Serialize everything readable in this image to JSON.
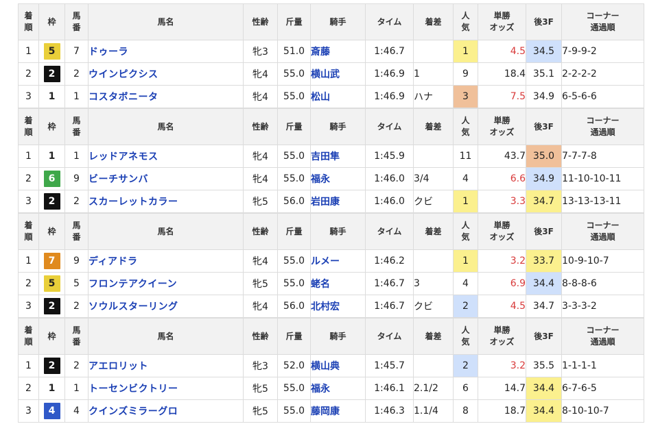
{
  "headers": {
    "chakujun": [
      "着",
      "順"
    ],
    "waku": "枠",
    "umaban": [
      "馬",
      "番"
    ],
    "bamei": "馬名",
    "seirei": "性齢",
    "kinryo": "斤量",
    "kishu": "騎手",
    "time": "タイム",
    "chakusa": "着差",
    "ninki": [
      "人",
      "気"
    ],
    "odds": [
      "単勝",
      "オッズ"
    ],
    "agari": "後3F",
    "corner": [
      "コーナー",
      "通過順"
    ]
  },
  "colors": {
    "waku1": "#ffffff",
    "waku2": "#111111",
    "waku4": "#2f58c8",
    "waku5": "#e9cf3a",
    "waku6": "#3fa84a",
    "waku7": "#e08a1e",
    "highlight_yellow": "#fbf08e",
    "highlight_blue": "#cfe0fb",
    "highlight_orange": "#f0c09a",
    "odds_red": "#d83a3a",
    "link_blue": "#1a3fb4"
  },
  "races": [
    {
      "rows": [
        {
          "rank": "1",
          "waku": "5",
          "umaban": "7",
          "name": "ドゥーラ",
          "seirei": "牝3",
          "kinryo": "51.0",
          "jockey": "斎藤",
          "time": "1:46.7",
          "margin": "",
          "ninki": "1",
          "ninki_hl": "yellow",
          "odds": "4.5",
          "odds_red": true,
          "agari": "34.5",
          "agari_hl": "blue",
          "corner": "7-9-9-2"
        },
        {
          "rank": "2",
          "waku": "2",
          "umaban": "2",
          "name": "ウインピクシス",
          "seirei": "牝4",
          "kinryo": "55.0",
          "jockey": "横山武",
          "time": "1:46.9",
          "margin": "1",
          "ninki": "9",
          "ninki_hl": "",
          "odds": "18.4",
          "odds_red": false,
          "agari": "35.1",
          "agari_hl": "",
          "corner": "2-2-2-2"
        },
        {
          "rank": "3",
          "waku": "1",
          "umaban": "1",
          "name": "コスタボニータ",
          "seirei": "牝4",
          "kinryo": "55.0",
          "jockey": "松山",
          "time": "1:46.9",
          "margin": "ハナ",
          "ninki": "3",
          "ninki_hl": "orange",
          "odds": "7.5",
          "odds_red": true,
          "agari": "34.9",
          "agari_hl": "",
          "corner": "6-5-6-6"
        }
      ]
    },
    {
      "rows": [
        {
          "rank": "1",
          "waku": "1",
          "umaban": "1",
          "name": "レッドアネモス",
          "seirei": "牝4",
          "kinryo": "55.0",
          "jockey": "吉田隼",
          "time": "1:45.9",
          "margin": "",
          "ninki": "11",
          "ninki_hl": "",
          "odds": "43.7",
          "odds_red": false,
          "agari": "35.0",
          "agari_hl": "orange",
          "corner": "7-7-7-8"
        },
        {
          "rank": "2",
          "waku": "6",
          "umaban": "9",
          "name": "ビーチサンバ",
          "seirei": "牝4",
          "kinryo": "55.0",
          "jockey": "福永",
          "time": "1:46.0",
          "margin": "3/4",
          "ninki": "4",
          "ninki_hl": "",
          "odds": "6.6",
          "odds_red": true,
          "agari": "34.9",
          "agari_hl": "blue",
          "corner": "11-10-10-11"
        },
        {
          "rank": "3",
          "waku": "2",
          "umaban": "2",
          "name": "スカーレットカラー",
          "seirei": "牝5",
          "kinryo": "56.0",
          "jockey": "岩田康",
          "time": "1:46.0",
          "margin": "クビ",
          "ninki": "1",
          "ninki_hl": "yellow",
          "odds": "3.3",
          "odds_red": true,
          "agari": "34.7",
          "agari_hl": "yellow",
          "corner": "13-13-13-11"
        }
      ]
    },
    {
      "rows": [
        {
          "rank": "1",
          "waku": "7",
          "umaban": "9",
          "name": "ディアドラ",
          "seirei": "牝4",
          "kinryo": "55.0",
          "jockey": "ルメー",
          "time": "1:46.2",
          "margin": "",
          "ninki": "1",
          "ninki_hl": "yellow",
          "odds": "3.2",
          "odds_red": true,
          "agari": "33.7",
          "agari_hl": "yellow",
          "corner": "10-9-10-7"
        },
        {
          "rank": "2",
          "waku": "5",
          "umaban": "5",
          "name": "フロンテアクイーン",
          "seirei": "牝5",
          "kinryo": "55.0",
          "jockey": "蛯名",
          "time": "1:46.7",
          "margin": "3",
          "ninki": "4",
          "ninki_hl": "",
          "odds": "6.9",
          "odds_red": true,
          "agari": "34.4",
          "agari_hl": "blue",
          "corner": "8-8-8-6"
        },
        {
          "rank": "3",
          "waku": "2",
          "umaban": "2",
          "name": "ソウルスターリング",
          "seirei": "牝4",
          "kinryo": "56.0",
          "jockey": "北村宏",
          "time": "1:46.7",
          "margin": "クビ",
          "ninki": "2",
          "ninki_hl": "blue",
          "odds": "4.5",
          "odds_red": true,
          "agari": "34.7",
          "agari_hl": "",
          "corner": "3-3-3-2"
        }
      ]
    },
    {
      "rows": [
        {
          "rank": "1",
          "waku": "2",
          "umaban": "2",
          "name": "アエロリット",
          "seirei": "牝3",
          "kinryo": "52.0",
          "jockey": "横山典",
          "time": "1:45.7",
          "margin": "",
          "ninki": "2",
          "ninki_hl": "blue",
          "odds": "3.2",
          "odds_red": true,
          "agari": "35.5",
          "agari_hl": "",
          "corner": "1-1-1-1"
        },
        {
          "rank": "2",
          "waku": "1",
          "umaban": "1",
          "name": "トーセンビクトリー",
          "seirei": "牝5",
          "kinryo": "55.0",
          "jockey": "福永",
          "time": "1:46.1",
          "margin": "2.1/2",
          "ninki": "6",
          "ninki_hl": "",
          "odds": "14.7",
          "odds_red": false,
          "agari": "34.4",
          "agari_hl": "yellow",
          "corner": "6-7-6-5"
        },
        {
          "rank": "3",
          "waku": "4",
          "umaban": "4",
          "name": "クインズミラーグロ",
          "seirei": "牝5",
          "kinryo": "55.0",
          "jockey": "藤岡康",
          "time": "1:46.3",
          "margin": "1.1/4",
          "ninki": "8",
          "ninki_hl": "",
          "odds": "18.7",
          "odds_red": false,
          "agari": "34.4",
          "agari_hl": "yellow",
          "corner": "8-10-10-7"
        }
      ]
    }
  ]
}
